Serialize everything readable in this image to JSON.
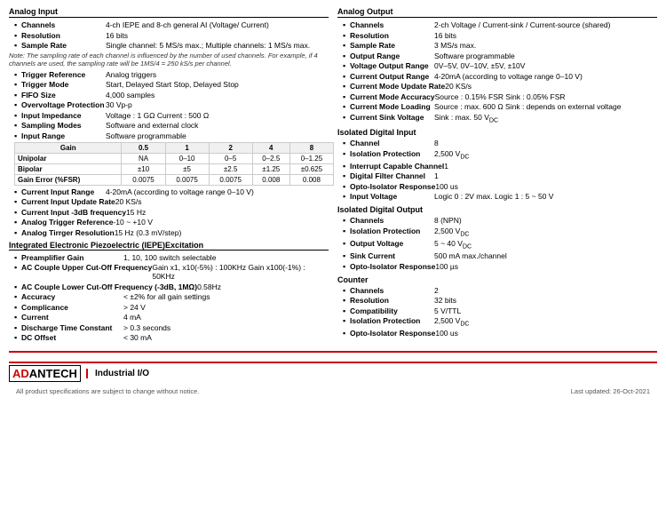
{
  "left_col": {
    "section_title": "Analog Input",
    "items": [
      {
        "label": "Channels",
        "value": "4-ch IEPE and 8-ch general AI (Voltage/ Current)"
      },
      {
        "label": "Resolution",
        "value": "16 bits"
      },
      {
        "label": "Sample Rate",
        "value": "Single channel: 5 MS/s max.; Multiple channels: 1 MS/s max."
      }
    ],
    "note": "Note: The sampling rate of each channel is influenced by the number of used channels. For example, if 4 channels are used, the sampling rate will be 1MS/4 = 250 kS/s per channel.",
    "items2": [
      {
        "label": "Trigger Reference",
        "value": "Analog triggers"
      },
      {
        "label": "Trigger Mode",
        "value": "Start, Delayed Start Stop, Delayed Stop"
      },
      {
        "label": "FIFO Size",
        "value": "4,000 samples"
      },
      {
        "label": "Overvoltage Protection",
        "value": "30 Vp-p"
      },
      {
        "label": "Input Impedance",
        "value": "Voltage : 1 GΩ Current : 500 Ω"
      },
      {
        "label": "Sampling Modes",
        "value": "Software and external clock"
      },
      {
        "label": "Input Range",
        "value": "Software programmable"
      }
    ],
    "gain_table": {
      "headers": [
        "Gain",
        "0.5",
        "1",
        "2",
        "4",
        "8"
      ],
      "rows": [
        [
          "Unipolar",
          "NA",
          "0–10",
          "0–5",
          "0–2.5",
          "0–1.25"
        ],
        [
          "Bipolar",
          "±10",
          "±5",
          "±2.5",
          "±1.25",
          "±0.625"
        ],
        [
          "Gain Error (%FSR)",
          "0.0075",
          "0.0075",
          "0.0075",
          "0.008",
          "0.008"
        ]
      ]
    },
    "items3": [
      {
        "label": "Current Input Range",
        "value": "4-20mA (according to voltage range 0–10 V)"
      },
      {
        "label": "Current Input Update Rate",
        "value": "20 KS/s"
      },
      {
        "label": "Current Input -3dB frequency",
        "value": "15 Hz"
      },
      {
        "label": "Analog Trigger Reference",
        "value": "-10 ~ +10 V"
      },
      {
        "label": "Analog Tirrger Resolution",
        "value": "15 Hz (0.3 mV/step)"
      }
    ],
    "iepe_title": "Integrated Electronic Piezoelectric (IEPE)Excitation",
    "iepe_items": [
      {
        "label": "Preamplifier Gain",
        "value": "1, 10, 100 switch selectable"
      },
      {
        "label": "AC Couple Upper Cut-Off Frequency",
        "value": "Gain x1, x10(-5%) : 100KHz Gain x100(-1%) : 50KHz"
      },
      {
        "label": "AC Couple Lower Cut-Off Frequency (-3dB, 1MΩ)",
        "value": "0.58Hz"
      },
      {
        "label": "Accuracy",
        "value": "< ±2% for all gain settings"
      },
      {
        "label": "Complicance",
        "value": "> 24 V"
      },
      {
        "label": "Current",
        "value": "4 mA"
      },
      {
        "label": "Discharge Time Constant",
        "value": "> 0.3 seconds"
      },
      {
        "label": "DC Offset",
        "value": "< 30 mA"
      }
    ]
  },
  "right_col": {
    "section_title": "Analog Output",
    "items": [
      {
        "label": "Channels",
        "value": "2-ch Voltage / Current-sink / Current-source (shared)"
      },
      {
        "label": "Resolution",
        "value": "16 bits"
      },
      {
        "label": "Sample Rate",
        "value": "3 MS/s max."
      },
      {
        "label": "Output Range",
        "value": "Software programmable"
      },
      {
        "label": "Voltage Output Range",
        "value": "0V–5V, 0V–10V, ±5V, ±10V"
      },
      {
        "label": "Current Output Range",
        "value": "4-20mA (according to voltage range 0–10 V)"
      },
      {
        "label": "Current Mode Update Rate",
        "value": "20 KS/s"
      },
      {
        "label": "Current Mode Accuracy",
        "value": "Source : 0.15% FSR Sink : 0.05% FSR"
      },
      {
        "label": "Current Mode Loading",
        "value": "Source : max. 600 Ω Sink : depends on external voltage"
      },
      {
        "label": "Current Sink Voltage",
        "value": "Sink : max. 50 VDC"
      }
    ],
    "iso_digital_input": {
      "title": "Isolated Digital Input",
      "items": [
        {
          "label": "Channel",
          "value": "8"
        },
        {
          "label": "Isolation Protection",
          "value": "2,500 VDC"
        },
        {
          "label": "Interrupt Capable Channel",
          "value": "1"
        },
        {
          "label": "Digital Filter Channel",
          "value": "1"
        },
        {
          "label": "Opto-Isolator Response",
          "value": "100 us"
        },
        {
          "label": "Input Voltage",
          "value": "Logic 0 : 2V max. Logic 1 : 5 ~ 50 V"
        }
      ]
    },
    "iso_digital_output": {
      "title": "Isolated Digital Output",
      "items": [
        {
          "label": "Channels",
          "value": "8 (NPN)"
        },
        {
          "label": "Isolation Protection",
          "value": "2,500 VDC"
        },
        {
          "label": "Output Voltage",
          "value": "5 ~ 40 VDC"
        },
        {
          "label": "Sink Current",
          "value": "500 mA max./channel"
        },
        {
          "label": "Opto-Isolator Response",
          "value": "100 µs"
        }
      ]
    },
    "counter": {
      "title": "Counter",
      "items": [
        {
          "label": "Channels",
          "value": "2"
        },
        {
          "label": "Resolution",
          "value": "32 bits"
        },
        {
          "label": "Compatibility",
          "value": "5 V/TTL"
        },
        {
          "label": "Isolation Protection",
          "value": "2,500 VDC"
        },
        {
          "label": "Opto-Isolator Response",
          "value": "100 us"
        }
      ]
    }
  },
  "footer": {
    "brand": "AD",
    "brand2": "ANTECH",
    "product": "Industrial I/O",
    "note": "All product specifications are subject to change without notice.",
    "date": "Last updated: 26-Oct-2021"
  }
}
